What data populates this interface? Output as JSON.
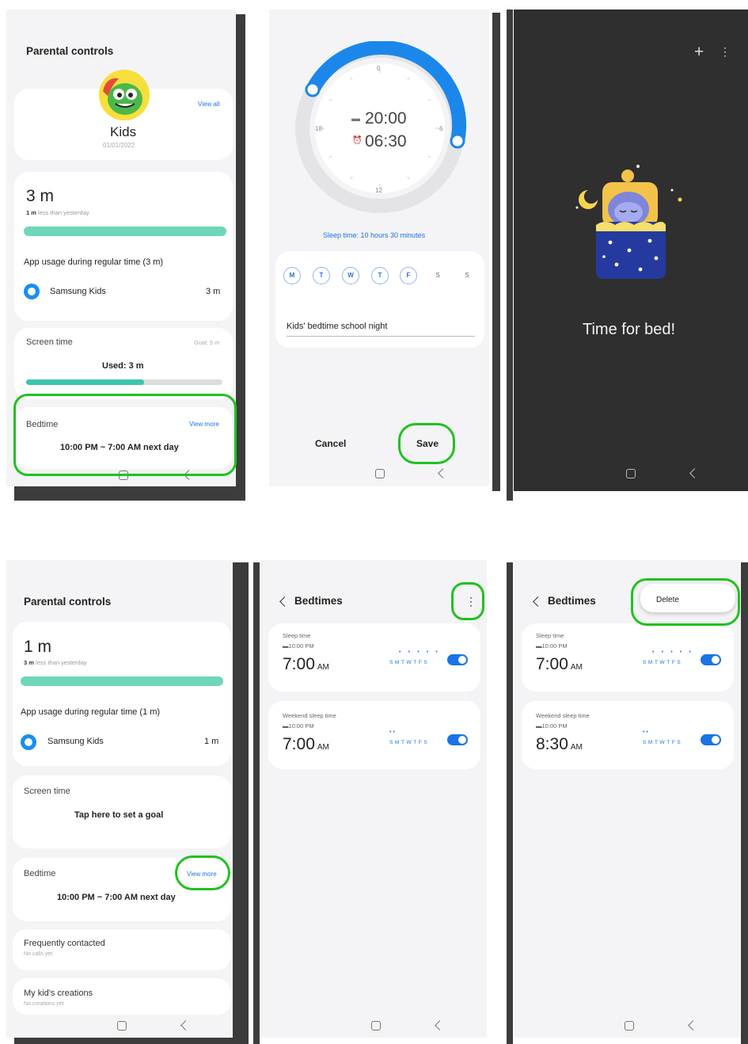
{
  "screen1": {
    "title": "Parental controls",
    "profile_name": "Kids",
    "profile_date": "01/01/2022",
    "view_all": "View all",
    "usage_value": "3 m",
    "usage_compare_bold": "1 m",
    "usage_compare_rest": " less than yesterday",
    "app_usage_title": "App usage during regular time (3 m)",
    "app_name": "Samsung Kids",
    "app_time": "3 m",
    "screen_time_label": "Screen time",
    "goal": "Goal: 5 m",
    "used": "Used: 3 m",
    "screen_time_progress": 0.6,
    "bedtime_label": "Bedtime",
    "view_more": "View more",
    "bedtime_range": "10:00 PM ~ 7:00 AM next day"
  },
  "screen2": {
    "dial_top": "0",
    "dial_left": "18",
    "dial_right": "6",
    "dial_bottom": "12",
    "bed_time": "20:00",
    "wake_time": "06:30",
    "sleep_summary": "Sleep time: 10 hours 30 minutes",
    "days": [
      {
        "label": "M",
        "active": true
      },
      {
        "label": "T",
        "active": true
      },
      {
        "label": "W",
        "active": true
      },
      {
        "label": "T",
        "active": true
      },
      {
        "label": "F",
        "active": true
      },
      {
        "label": "S",
        "active": false
      },
      {
        "label": "S",
        "active": false
      }
    ],
    "schedule_name": "Kids' bedtime school night",
    "cancel": "Cancel",
    "save": "Save"
  },
  "screen3": {
    "message": "Time for bed!",
    "add_icon": "plus-icon",
    "more_icon": "more-vertical-icon"
  },
  "screen4": {
    "title": "Parental controls",
    "usage_value": "1 m",
    "usage_compare_bold": "3 m",
    "usage_compare_rest": " less than yesterday",
    "app_usage_title": "App usage during regular time (1 m)",
    "app_name": "Samsung Kids",
    "app_time": "1 m",
    "screen_time_label": "Screen time",
    "set_goal": "Tap here to set a goal",
    "bedtime_label": "Bedtime",
    "view_more": "View more",
    "bedtime_range": "10:00 PM ~ 7:00 AM next day",
    "frequent_title": "Frequently contacted",
    "frequent_sub": "No calls yet",
    "creations_title": "My kid's creations",
    "creations_sub": "No creations yet"
  },
  "screen5": {
    "title": "Bedtimes",
    "item1_label": "Sleep time",
    "item1_start": "10:00 PM",
    "item1_time": "7:00",
    "item1_ampm": "AM",
    "item1_days": "SMTWTFS",
    "item1_dots": "• • • • •",
    "item2_label": "Weekend sleep time",
    "item2_start": "10:00 PM",
    "item2_time": "7:00",
    "item2_ampm": "AM",
    "item2_days": "SMTWTFS",
    "item2_dots": "•           •"
  },
  "screen6": {
    "title": "Bedtimes",
    "delete": "Delete",
    "item1_label": "Sleep time",
    "item1_start": "10:00 PM",
    "item1_time": "7:00",
    "item1_ampm": "AM",
    "item1_days": "SMTWTFS",
    "item1_dots": "• • • • •",
    "item2_label": "Weekend sleep time",
    "item2_start": "10:00 PM",
    "item2_time": "8:30",
    "item2_ampm": "AM",
    "item2_days": "SMTWTFS",
    "item2_dots": "•           •"
  },
  "colors": {
    "highlight": "#1fc21f",
    "accent_blue": "#1b73e8",
    "progress_teal": "#6ed6b9",
    "dark_screen": "#2f2f2f"
  }
}
